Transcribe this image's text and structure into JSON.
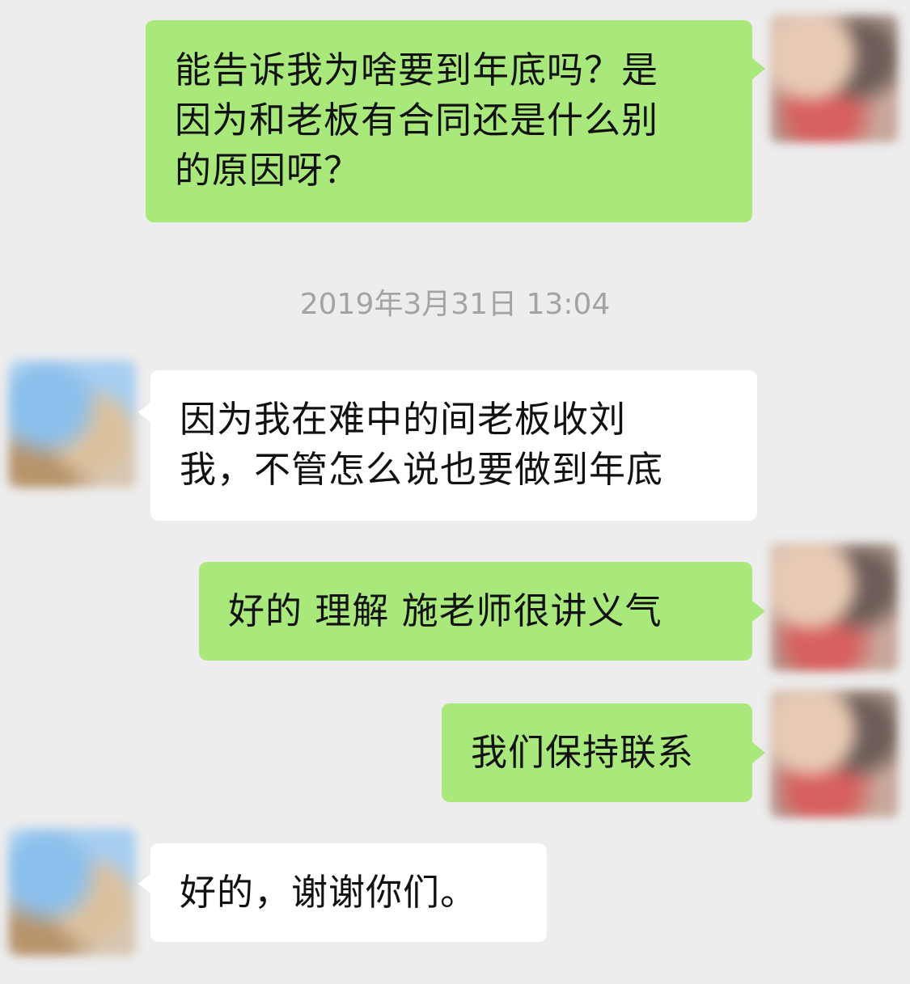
{
  "chat": {
    "messages": [
      {
        "sender": "me",
        "text": "能告诉我为啥要到年底吗？是\n因为和老板有合同还是什么别\n的原因呀？"
      },
      {
        "sender": "other",
        "text": "因为我在难中的间老板收刘\n我，不管怎么说也要做到年底"
      },
      {
        "sender": "me",
        "text": "好的 理解 施老师很讲义气"
      },
      {
        "sender": "me",
        "text": "我们保持联系"
      },
      {
        "sender": "other",
        "text": "好的，谢谢你们。"
      }
    ],
    "timestamp": "2019年3月31日 13:04"
  },
  "colors": {
    "background": "#ededed",
    "outgoing_bubble": "#a9e97b",
    "incoming_bubble": "#ffffff",
    "timestamp_text": "#a3a3a3"
  }
}
